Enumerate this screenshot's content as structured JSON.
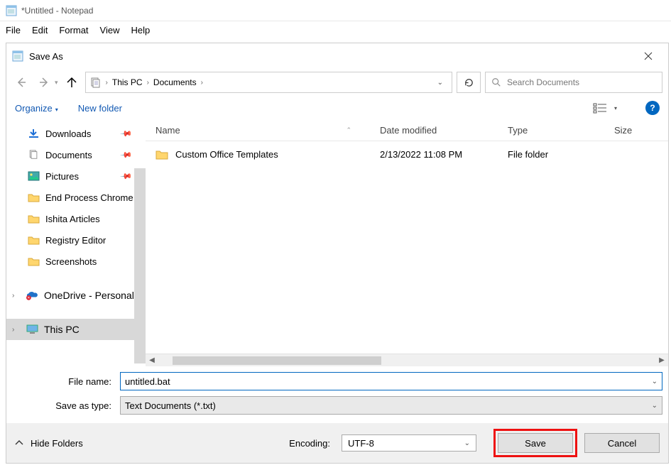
{
  "notepad": {
    "title": "*Untitled - Notepad",
    "menu": [
      "File",
      "Edit",
      "Format",
      "View",
      "Help"
    ]
  },
  "dialog": {
    "title": "Save As",
    "breadcrumb": [
      "This PC",
      "Documents"
    ],
    "search_placeholder": "Search Documents",
    "toolbar": {
      "organize": "Organize",
      "new_folder": "New folder"
    },
    "tree": [
      {
        "icon": "downloads",
        "label": "Downloads",
        "pinned": true
      },
      {
        "icon": "documents",
        "label": "Documents",
        "pinned": true
      },
      {
        "icon": "pictures",
        "label": "Pictures",
        "pinned": true
      },
      {
        "icon": "folder",
        "label": "End Process Chrome"
      },
      {
        "icon": "folder",
        "label": "Ishita Articles"
      },
      {
        "icon": "folder",
        "label": "Registry Editor"
      },
      {
        "icon": "folder",
        "label": "Screenshots"
      },
      {
        "icon": "onedrive",
        "label": "OneDrive - Personal",
        "level": 1,
        "gap_before": true
      },
      {
        "icon": "thispc",
        "label": "This PC",
        "level": 1,
        "selected": true,
        "gap_before": true
      }
    ],
    "columns": {
      "name": "Name",
      "date": "Date modified",
      "type": "Type",
      "size": "Size"
    },
    "rows": [
      {
        "name": "Custom Office Templates",
        "date": "2/13/2022 11:08 PM",
        "type": "File folder"
      }
    ],
    "filename_label": "File name:",
    "filename_value": "untitled.bat",
    "savetype_label": "Save as type:",
    "savetype_value": "Text Documents (*.txt)",
    "encoding_label": "Encoding:",
    "encoding_value": "UTF-8",
    "hide_folders": "Hide Folders",
    "save": "Save",
    "cancel": "Cancel"
  }
}
